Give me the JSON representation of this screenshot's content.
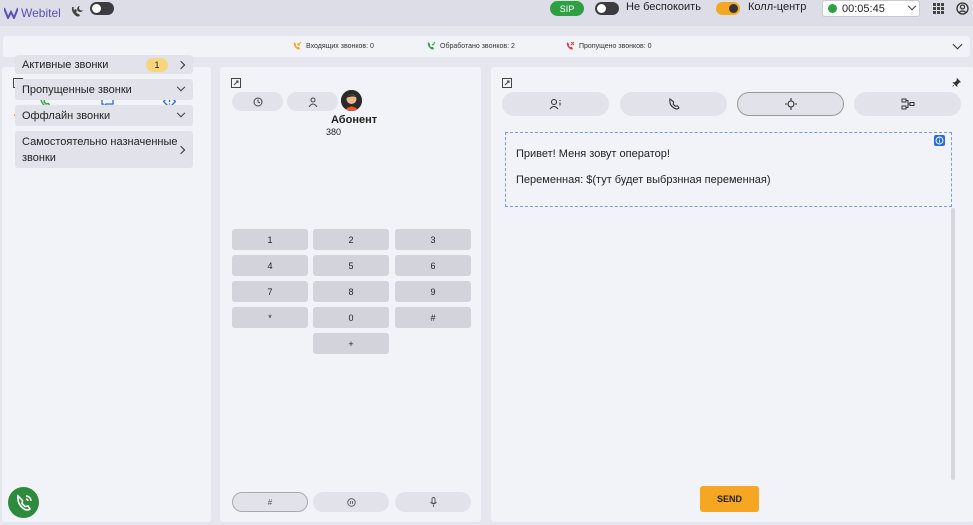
{
  "topbar": {
    "logo": "Webitel",
    "sip": "SIP",
    "dnd_label": "Не беспокоить",
    "callcenter_label": "Колл-центр",
    "timer": "00:05:45"
  },
  "stats": {
    "incoming": "Входящих звонков: 0",
    "processed": "Обработано звонков: 2",
    "missed": "Пропущено звонков: 0"
  },
  "left": {
    "items": [
      {
        "label": "Активные звонки",
        "badge": "1"
      },
      {
        "label": "Пропущенные звонки"
      },
      {
        "label": "Оффлайн звонки"
      },
      {
        "label": "Самостоятельно назначенные звонки"
      }
    ]
  },
  "middle": {
    "subscriber_name": "Абонент",
    "subscriber_number": "380",
    "keys": [
      "1",
      "2",
      "3",
      "4",
      "5",
      "6",
      "7",
      "8",
      "9",
      "*",
      "0",
      "#",
      "+"
    ],
    "hash": "#"
  },
  "right": {
    "script_line1": "Привет! Меня зовут оператор!",
    "script_line2": "Переменная: $(тут будет выбрзнная переменная)",
    "send": "SEND"
  },
  "colors": {
    "accent": "#f5a623",
    "green": "#2ea043",
    "blue": "#2d6bd6",
    "purple": "#5a51b5"
  }
}
